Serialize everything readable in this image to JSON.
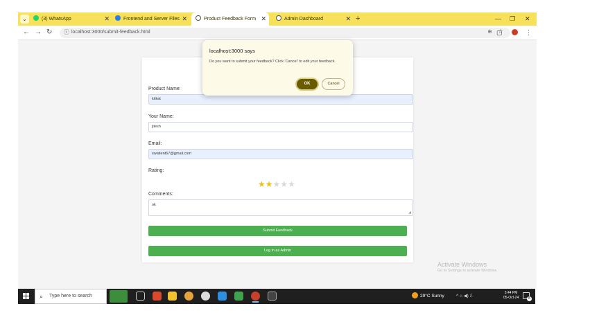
{
  "browser": {
    "tabs": [
      {
        "label": "(3) WhatsApp",
        "favicon_color": "#25d366"
      },
      {
        "label": "Frontend and Server Files",
        "favicon_color": "#2f7de1"
      },
      {
        "label": "Product Feedback Form",
        "favicon_color": "#555555"
      },
      {
        "label": "Admin Dashboard",
        "favicon_color": "#555555"
      }
    ],
    "active_tab_index": 2,
    "new_tab_label": "+",
    "url": "localhost:3000/submit-feedback.html",
    "tab_bar_color": "#f7e05a"
  },
  "dialog": {
    "title": "localhost:3000 says",
    "message": "Do you want to submit your feedback? Click 'Cancel' to edit your feedback.",
    "ok_label": "OK",
    "cancel_label": "Cancel"
  },
  "form": {
    "product_label": "Product Name:",
    "product_value": "kitkat",
    "name_label": "Your Name:",
    "name_value": "jitesh",
    "email_label": "Email:",
    "email_value": "swatient67@gmail.com",
    "rating_label": "Rating:",
    "rating_value": 2,
    "rating_max": 5,
    "comments_label": "Comments:",
    "comments_value": "ok",
    "submit_label": "Submit Feedback",
    "admin_label": "Log in as Admin",
    "button_color": "#4caf50"
  },
  "watermark": {
    "title": "Activate Windows",
    "subtitle": "Go to Settings to activate Windows."
  },
  "taskbar": {
    "search_placeholder": "Type here to search",
    "weather": "29°C  Sunny",
    "time": "3:44 PM",
    "date": "05-Oct-24",
    "notification_count": "8"
  }
}
